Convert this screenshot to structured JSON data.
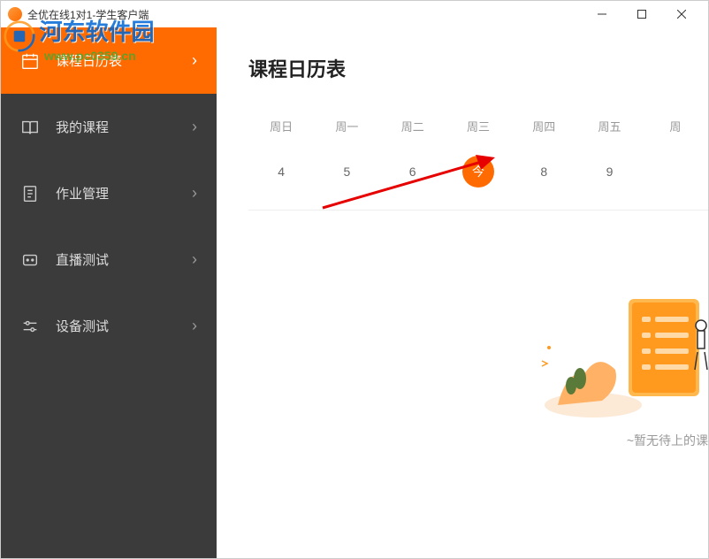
{
  "window": {
    "title": "全优在线1对1-学生客户端"
  },
  "watermark": {
    "line1": "河东软件园",
    "line2": "www.pc0359.cn"
  },
  "sidebar": {
    "items": [
      {
        "label": "课程日历表",
        "icon": "calendar"
      },
      {
        "label": "我的课程",
        "icon": "book"
      },
      {
        "label": "作业管理",
        "icon": "document"
      },
      {
        "label": "直播测试",
        "icon": "live"
      },
      {
        "label": "设备测试",
        "icon": "settings"
      }
    ]
  },
  "main": {
    "title": "课程日历表"
  },
  "calendar": {
    "days": [
      {
        "name": "周日",
        "num": "4"
      },
      {
        "name": "周一",
        "num": "5"
      },
      {
        "name": "周二",
        "num": "6"
      },
      {
        "name": "周三",
        "num": "今",
        "today": true
      },
      {
        "name": "周四",
        "num": "8"
      },
      {
        "name": "周五",
        "num": "9"
      },
      {
        "name": "周",
        "num": ""
      }
    ]
  },
  "empty": {
    "text": "~暂无待上的课"
  }
}
